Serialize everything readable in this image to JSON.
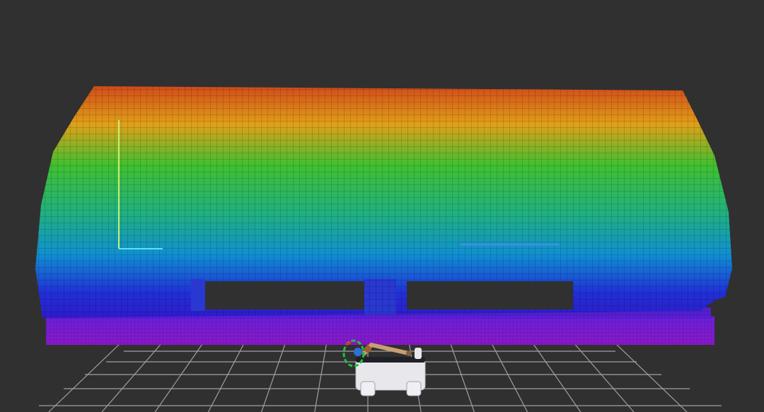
{
  "scene": {
    "background_color": "#303030",
    "grid_color": "#a0a0a0",
    "colormap": "rainbow-by-height",
    "colormap_stops": [
      "#d0401a",
      "#e0c010",
      "#30c030",
      "#10a0c0",
      "#2030d0",
      "#8020d8"
    ],
    "objects": [
      {
        "name": "point-cloud",
        "description_icon": "voxel-point-cloud-icon"
      },
      {
        "name": "robot",
        "description_icon": "mobile-manipulator-robot-icon"
      },
      {
        "name": "ground-grid",
        "description_icon": "grid-icon"
      }
    ]
  }
}
